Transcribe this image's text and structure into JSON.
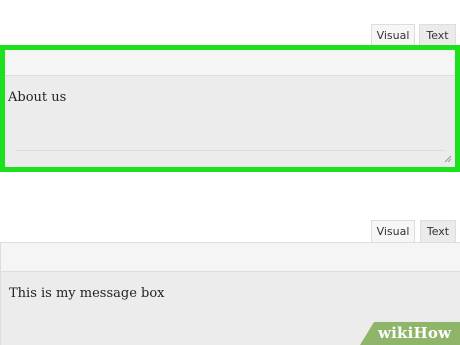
{
  "editor1": {
    "tabs": {
      "visual_label": "Visual",
      "text_label": "Text"
    },
    "content": "About us",
    "highlight_color": "#1ee11e"
  },
  "editor2": {
    "tabs": {
      "visual_label": "Visual",
      "text_label": "Text"
    },
    "content": "This is my message box"
  },
  "watermark": {
    "text": "wikiHow",
    "color": "#8fb56a"
  }
}
